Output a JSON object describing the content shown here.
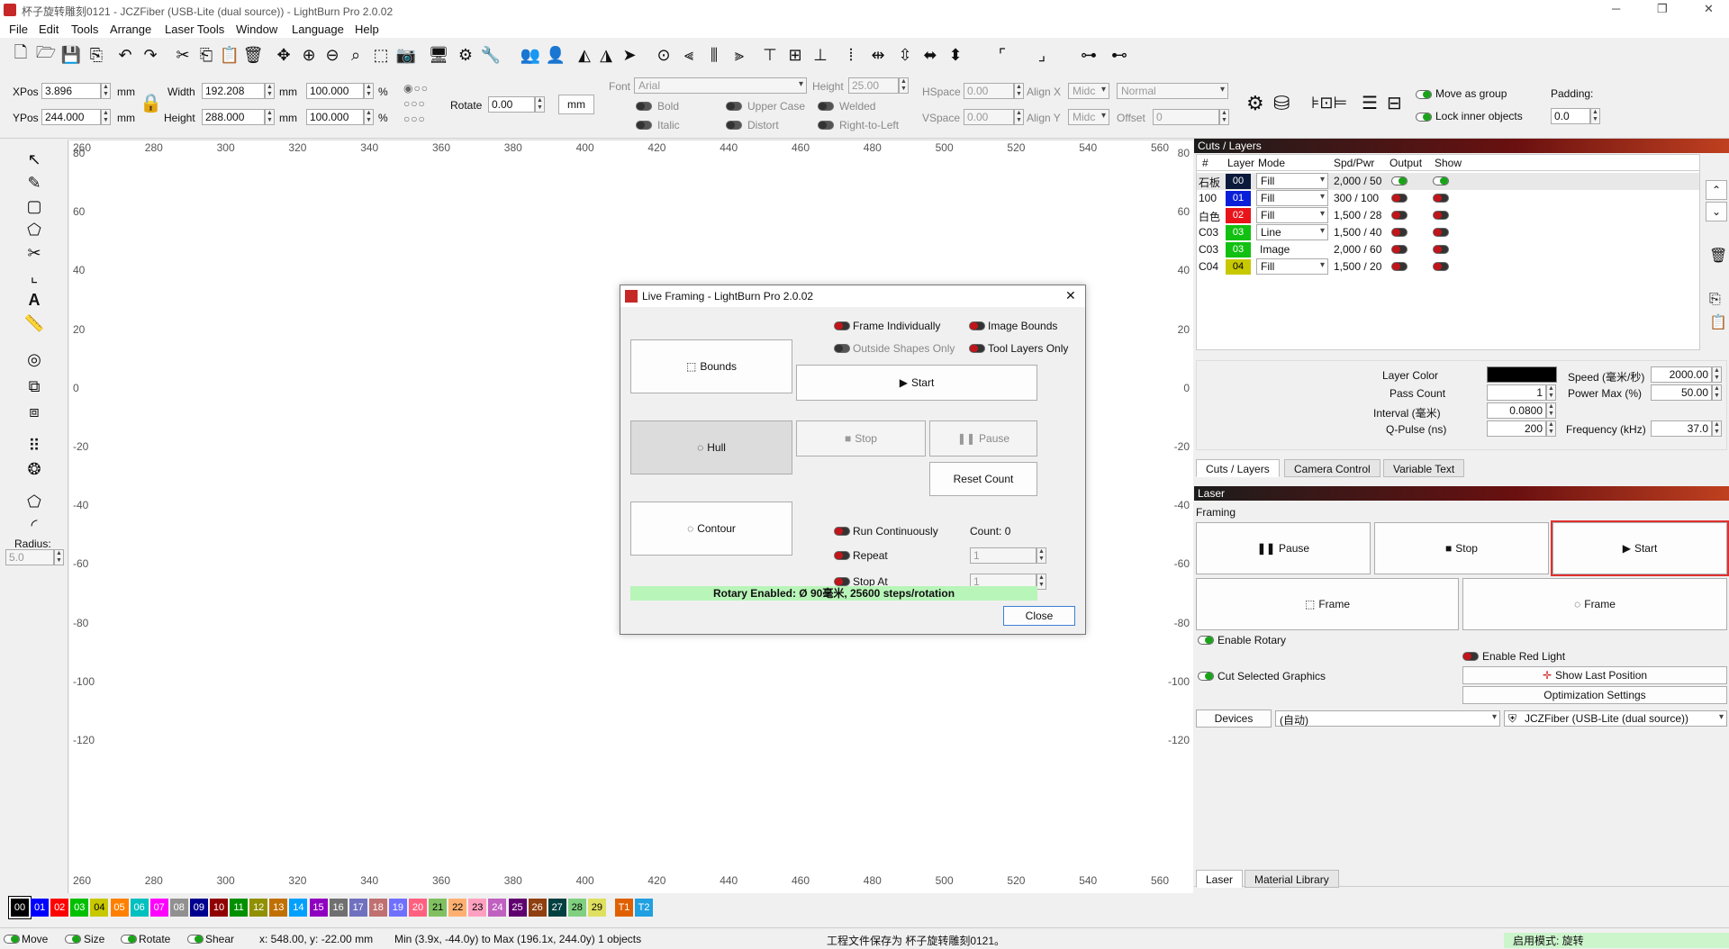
{
  "window": {
    "title": "杯子旋转雕刻0121 - JCZFiber (USB-Lite (dual source)) - LightBurn Pro 2.0.02",
    "minimize": "─",
    "restore": "❐",
    "close": "✕"
  },
  "menu": [
    "File",
    "Edit",
    "Tools",
    "Arrange",
    "Laser Tools",
    "Window",
    "Language",
    "Help"
  ],
  "props": {
    "xpos_label": "XPos",
    "xpos": "3.896",
    "ypos_label": "YPos",
    "ypos": "244.000",
    "unit": "mm",
    "width_label": "Width",
    "width": "192.208",
    "height_label": "Height",
    "height": "288.000",
    "scale_w": "100.000",
    "scale_h": "100.000",
    "pct": "%",
    "rotate_label": "Rotate",
    "rotate": "0.00",
    "mm_btn": "mm",
    "font_label": "Font",
    "font": "Arial",
    "fheight_label": "Height",
    "fheight": "25.00",
    "hspace_label": "HSpace",
    "hspace": "0.00",
    "vspace_label": "VSpace",
    "vspace": "0.00",
    "alignx_label": "Align X",
    "alignx": "Midc",
    "aligny_label": "Align Y",
    "aligny": "Midc",
    "normal": "Normal",
    "offset_label": "Offset",
    "offset": "0",
    "bold": "Bold",
    "italic": "Italic",
    "upper": "Upper Case",
    "distort": "Distort",
    "welded": "Welded",
    "rtl": "Right-to-Left",
    "move_group": "Move as group",
    "lock_inner": "Lock inner objects",
    "padding_label": "Padding:",
    "padding": "0.0",
    "radius_label": "Radius:",
    "radius": "5.0"
  },
  "ruler": {
    "top": [
      "260",
      "280",
      "300",
      "320",
      "340",
      "360",
      "380",
      "400",
      "420",
      "440",
      "460",
      "480",
      "500",
      "520",
      "540",
      "560"
    ],
    "left": [
      "80",
      "60",
      "40",
      "20",
      "0",
      "-20",
      "-40",
      "-60",
      "-80",
      "-100",
      "-120"
    ],
    "right": [
      "80",
      "60",
      "40",
      "20",
      "0",
      "-20",
      "-40",
      "-60",
      "-80",
      "-100",
      "-120"
    ]
  },
  "cuts": {
    "title": "Cuts / Layers",
    "headers": [
      "#",
      "Layer",
      "Mode",
      "Spd/Pwr",
      "Output",
      "Show"
    ],
    "rows": [
      {
        "num": "石板",
        "layer": "00",
        "color": "#0b1a3a",
        "mode": "Fill",
        "sp": "2,000 / 50",
        "out": "on",
        "show": "on",
        "combo": true
      },
      {
        "num": "100",
        "layer": "01",
        "color": "#0a1fd8",
        "mode": "Fill",
        "sp": "300 / 100",
        "out": "off",
        "show": "off",
        "combo": true
      },
      {
        "num": "白色",
        "layer": "02",
        "color": "#e8141a",
        "mode": "Fill",
        "sp": "1,500 / 28",
        "out": "off",
        "show": "off",
        "combo": true
      },
      {
        "num": "C03",
        "layer": "03",
        "color": "#12c012",
        "mode": "Line",
        "sp": "1,500 / 40",
        "out": "off",
        "show": "off",
        "combo": true
      },
      {
        "num": "C03",
        "layer": "03",
        "color": "#12c012",
        "mode": "Image",
        "sp": "2,000 / 60",
        "out": "off",
        "show": "off",
        "combo": false
      },
      {
        "num": "C04",
        "layer": "04",
        "color": "#c8c800",
        "mode": "Fill",
        "sp": "1,500 / 20",
        "out": "off",
        "show": "off",
        "combo": true
      }
    ],
    "layer_color_label": "Layer Color",
    "layer_color": "#000000",
    "speed_label": "Speed (毫米/秒)",
    "speed": "2000.00",
    "pass_label": "Pass Count",
    "pass": "1",
    "power_label": "Power Max (%)",
    "power": "50.00",
    "interval_label": "Interval (毫米)",
    "interval": "0.0800",
    "qpulse_label": "Q-Pulse (ns)",
    "qpulse": "200",
    "freq_label": "Frequency (kHz)",
    "freq": "37.0",
    "tabs": [
      "Cuts / Layers",
      "Camera Control",
      "Variable Text"
    ]
  },
  "laser": {
    "title": "Laser",
    "framing": "Framing",
    "pause": "Pause",
    "stop": "Stop",
    "start": "Start",
    "frame1": "Frame",
    "frame2": "Frame",
    "enable_rotary": "Enable Rotary",
    "enable_red": "Enable Red Light",
    "cut_selected": "Cut Selected Graphics",
    "show_last": "Show Last Position",
    "optim": "Optimization Settings",
    "devices": "Devices",
    "port": "(自动)",
    "device": "JCZFiber (USB-Lite (dual source))",
    "tabs": [
      "Laser",
      "Material Library"
    ]
  },
  "dialog": {
    "title": "Live Framing - LightBurn Pro 2.0.02",
    "bounds": "Bounds",
    "hull": "Hull",
    "contour": "Contour",
    "frame_ind": "Frame Individually",
    "image_bounds": "Image Bounds",
    "outside_only": "Outside Shapes Only",
    "tool_layers": "Tool Layers Only",
    "start": "Start",
    "stop": "Stop",
    "pause": "Pause",
    "reset": "Reset Count",
    "run_cont": "Run Continuously",
    "count": "Count: 0",
    "repeat": "Repeat",
    "repeat_val": "1",
    "stop_at": "Stop At",
    "stop_at_val": "1",
    "rotary": "Rotary Enabled: Ø 90毫米, 25600 steps/rotation",
    "close": "Close"
  },
  "palette": [
    {
      "n": "00",
      "c": "#000000"
    },
    {
      "n": "01",
      "c": "#0000ff"
    },
    {
      "n": "02",
      "c": "#ff0000"
    },
    {
      "n": "03",
      "c": "#00c000"
    },
    {
      "n": "04",
      "c": "#c8c800"
    },
    {
      "n": "05",
      "c": "#ff8000"
    },
    {
      "n": "06",
      "c": "#00c0c0"
    },
    {
      "n": "07",
      "c": "#ff00ff"
    },
    {
      "n": "08",
      "c": "#909090"
    },
    {
      "n": "09",
      "c": "#000090"
    },
    {
      "n": "10",
      "c": "#900000"
    },
    {
      "n": "11",
      "c": "#009000"
    },
    {
      "n": "12",
      "c": "#909000"
    },
    {
      "n": "13",
      "c": "#c07000"
    },
    {
      "n": "14",
      "c": "#00a0ff"
    },
    {
      "n": "15",
      "c": "#9000c0"
    },
    {
      "n": "16",
      "c": "#707070"
    },
    {
      "n": "17",
      "c": "#7070c0"
    },
    {
      "n": "18",
      "c": "#c07070"
    },
    {
      "n": "19",
      "c": "#7070ff"
    },
    {
      "n": "20",
      "c": "#ff6080"
    },
    {
      "n": "21",
      "c": "#80c060"
    },
    {
      "n": "22",
      "c": "#ffb070"
    },
    {
      "n": "23",
      "c": "#ffa0c0"
    },
    {
      "n": "24",
      "c": "#c060c0"
    },
    {
      "n": "25",
      "c": "#600070"
    },
    {
      "n": "26",
      "c": "#904010"
    },
    {
      "n": "27",
      "c": "#004040"
    },
    {
      "n": "28",
      "c": "#80d080"
    },
    {
      "n": "29",
      "c": "#e0e060"
    },
    {
      "n": "T1",
      "c": "#e06000"
    },
    {
      "n": "T2",
      "c": "#20a0e0"
    }
  ],
  "status": {
    "move": "Move",
    "size": "Size",
    "rotate": "Rotate",
    "shear": "Shear",
    "coords": "x: 548.00, y: -22.00 mm",
    "range": "Min (3.9x, -44.0y) to Max (196.1x, 244.0y)  1 objects",
    "saved": "工程文件保存为 杯子旋转雕刻0121。",
    "mode": "启用模式:   旋转"
  }
}
